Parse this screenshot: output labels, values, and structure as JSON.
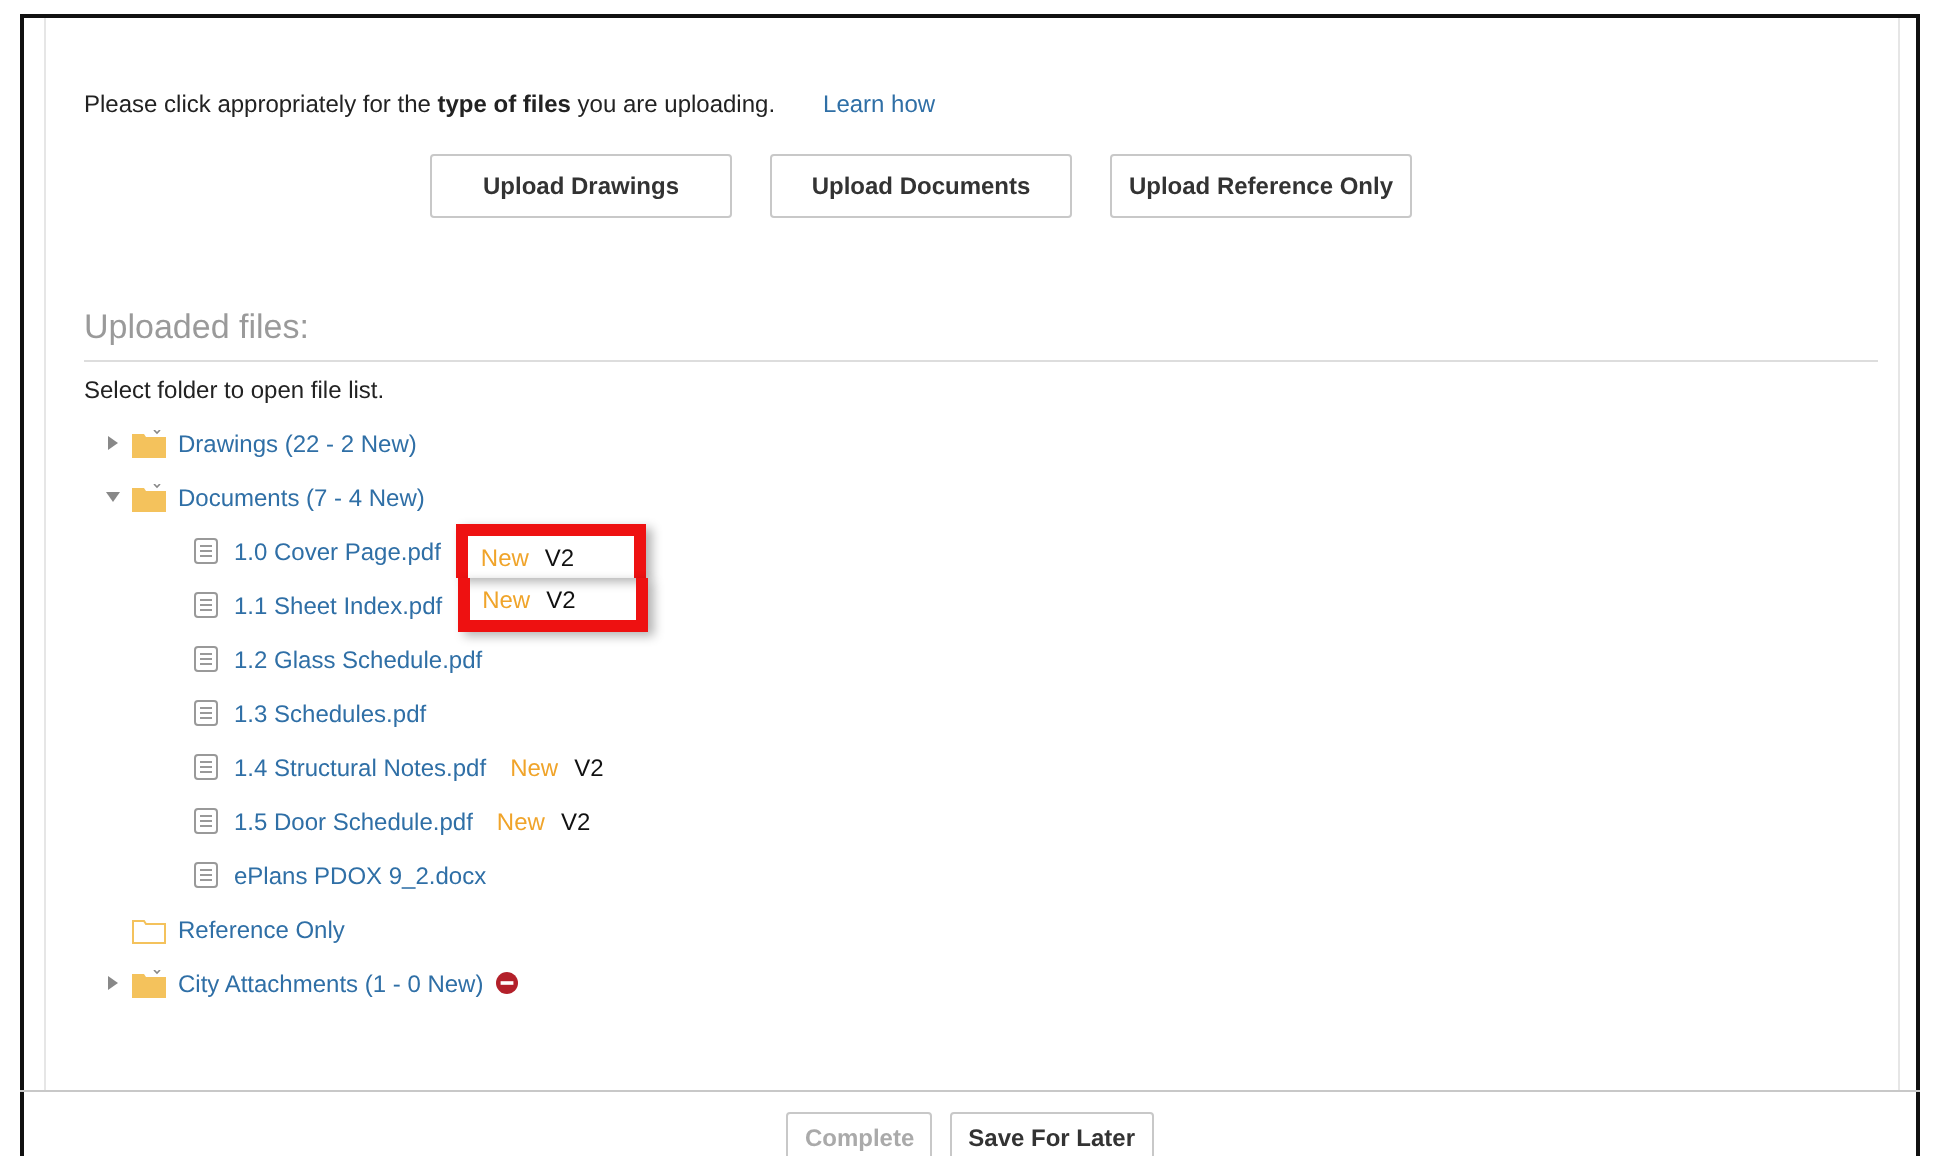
{
  "intro": {
    "text": "Please click appropriately for the **type of files** you are uploading.",
    "link": "Learn how"
  },
  "upload_buttons": [
    "Upload Drawings",
    "Upload Documents",
    "Upload Reference Only"
  ],
  "uploaded": {
    "heading": "Uploaded files:",
    "hint": "Select folder to open file list.",
    "tree": [
      {
        "kind": "folder",
        "label": "Drawings (22 - 2 New)",
        "expanded": false
      },
      {
        "kind": "folder",
        "label": "Documents (7 - 4 New)",
        "expanded": true,
        "children": [
          {
            "label": "1.0 Cover Page.pdf",
            "badge": "New",
            "version": "V2",
            "highlighted": true
          },
          {
            "label": "1.1 Sheet Index.pdf",
            "badge": "New",
            "version": "V2",
            "highlighted": true
          },
          {
            "label": "1.2 Glass Schedule.pdf"
          },
          {
            "label": "1.3 Schedules.pdf"
          },
          {
            "label": "1.4 Structural Notes.pdf",
            "badge": "New",
            "version": "V2"
          },
          {
            "label": "1.5 Door Schedule.pdf",
            "badge": "New",
            "version": "V2"
          },
          {
            "label": "ePlans PDOX 9_2.docx"
          }
        ]
      },
      {
        "kind": "empty_folder",
        "label": "Reference Only"
      },
      {
        "kind": "folder",
        "label": "City Attachments (1 - 0 New)",
        "expanded": false,
        "blocked": true
      }
    ]
  },
  "footer_buttons": [
    {
      "label": "Complete",
      "disabled": true
    },
    {
      "label": "Save For Later",
      "disabled": false
    }
  ]
}
